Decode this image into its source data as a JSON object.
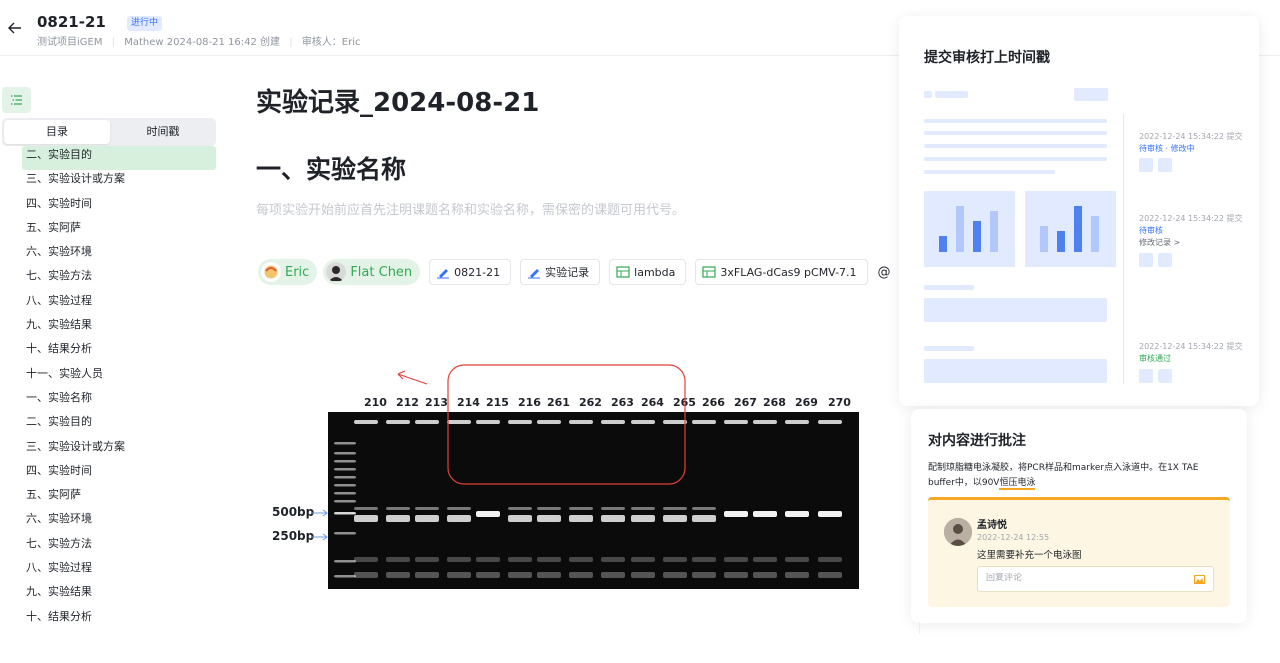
{
  "header": {
    "title": "0821-21",
    "status": "进行中",
    "project": "测试项目iGEM",
    "creator": "Mathew 2024-08-21 16:42 创建",
    "reviewer": "审核人：Eric"
  },
  "sidebar": {
    "tabs": [
      "目录",
      "时间戳"
    ],
    "items": [
      "二、实验目的",
      "三、实验设计或方案",
      "四、实验时间",
      "五、实阿萨",
      "六、实验环境",
      "七、实验方法",
      "八、实验过程",
      "九、实验结果",
      "十、结果分析",
      "十一、实验人员",
      "一、实验名称",
      "二、实验目的",
      "三、实验设计或方案",
      "四、实验时间",
      "五、实阿萨",
      "六、实验环境",
      "七、实验方法",
      "八、实验过程",
      "九、实验结果",
      "十、结果分析"
    ]
  },
  "main": {
    "title": "实验记录_2024-08-21",
    "section_title": "一、实验名称",
    "placeholder_hint": "每项实验开始前应首先注明课题名称和实验名称，需保密的课题可用代号。",
    "mentions": [
      "Eric",
      "Flat Chen"
    ],
    "refs": [
      "0821-21",
      "实验记录",
      "lambda",
      "3xFLAG-dCas9 pCMV-7.1"
    ],
    "at_symbol": "@",
    "gel": {
      "lanes": [
        "210",
        "212",
        "213",
        "214",
        "215",
        "216",
        "261",
        "262",
        "263",
        "264",
        "265",
        "266",
        "267",
        "268",
        "269",
        "270"
      ],
      "markers": [
        "500bp",
        "250bp"
      ]
    }
  },
  "review_panel": {
    "title": "提交审核打上时间戳",
    "entries": [
      {
        "time": "2022-12-24 15:34:22 提交",
        "status": "待审核 · 修改中",
        "status_color": "#3370ff"
      },
      {
        "time": "2022-12-24 15:34:22 提交",
        "status": "待审核",
        "status_color": "#3370ff",
        "extra": "修改记录 >"
      },
      {
        "time": "2022-12-24 15:34:22 提交",
        "status": "审核通过",
        "status_color": "#34a853"
      }
    ]
  },
  "annotation_panel": {
    "title": "对内容进行批注",
    "body_prefix": "配制琼脂糖电泳凝胶，将PCR样品和marker点入泳道中。在1X TAE buffer中，以90V",
    "body_highlight": "恒压电泳",
    "comment": {
      "author": "孟诗悦",
      "time": "2022-12-24 12:55",
      "text": "这里需要补充一个电泳图",
      "reply_placeholder": "回复评论"
    }
  },
  "colors": {
    "accent_green": "#34a853",
    "accent_blue": "#3370ff",
    "highlight_orange": "#f5a623",
    "annotation_red": "#e0413a"
  }
}
